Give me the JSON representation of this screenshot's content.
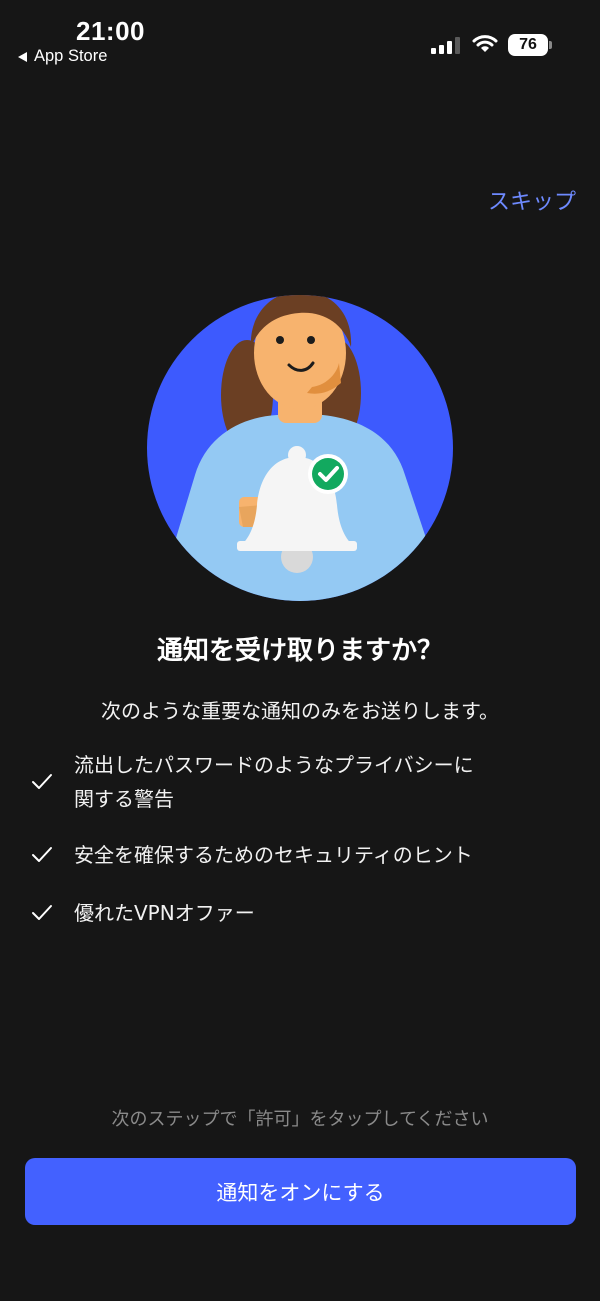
{
  "status_bar": {
    "time": "21:00",
    "back_app": "App Store",
    "battery": "76",
    "icons": [
      "signal-icon",
      "wifi-icon",
      "battery-icon"
    ]
  },
  "skip_label": "スキップ",
  "title": "通知を受け取りますか？",
  "lead": "次のような重要な通知のみをお送りします。",
  "items": [
    {
      "line1": "流出したパスワードのようなプライバシーに",
      "line2": "関する警告"
    },
    {
      "line1": "安全を確保するためのセキュリティのヒント"
    },
    {
      "line1": "優れたVPNオファー"
    }
  ],
  "hint": "次のステップで「許可」をタップしてください",
  "cta_label": "通知をオンにする",
  "colors": {
    "background": "#161616",
    "accent": "#4361ff",
    "link": "#6e8aff",
    "illustration_circle": "#3d5afe",
    "check_badge": "#12a95f"
  }
}
